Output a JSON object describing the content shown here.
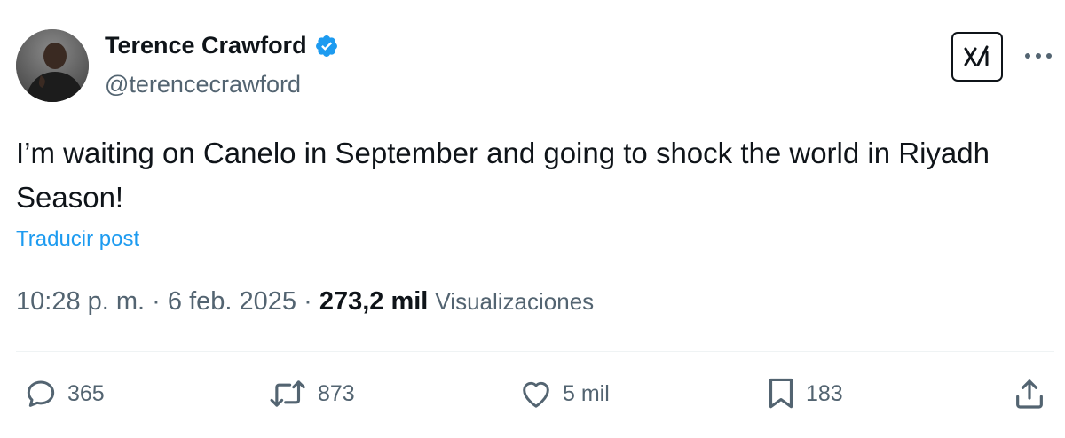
{
  "author": {
    "name": "Terence Crawford",
    "handle": "@terencecrawford",
    "verified": true,
    "verified_color": "#1d9bf0"
  },
  "header_actions": {
    "grok_icon": "grok-icon",
    "more_icon": "more-icon"
  },
  "tweet": {
    "text": "I’m waiting on Canelo in September and going to shock the world in Riyadh Season!",
    "translate_label": "Traducir post"
  },
  "meta": {
    "time": "10:28 p. m.",
    "separator": "·",
    "date": "6 feb. 2025",
    "views_count": "273,2 mil",
    "views_label": "Visualizaciones"
  },
  "actions": {
    "replies": "365",
    "reposts": "873",
    "likes": "5 mil",
    "bookmarks": "183"
  },
  "colors": {
    "accent": "#1d9bf0",
    "text_primary": "#0f1419",
    "text_secondary": "#536471"
  }
}
